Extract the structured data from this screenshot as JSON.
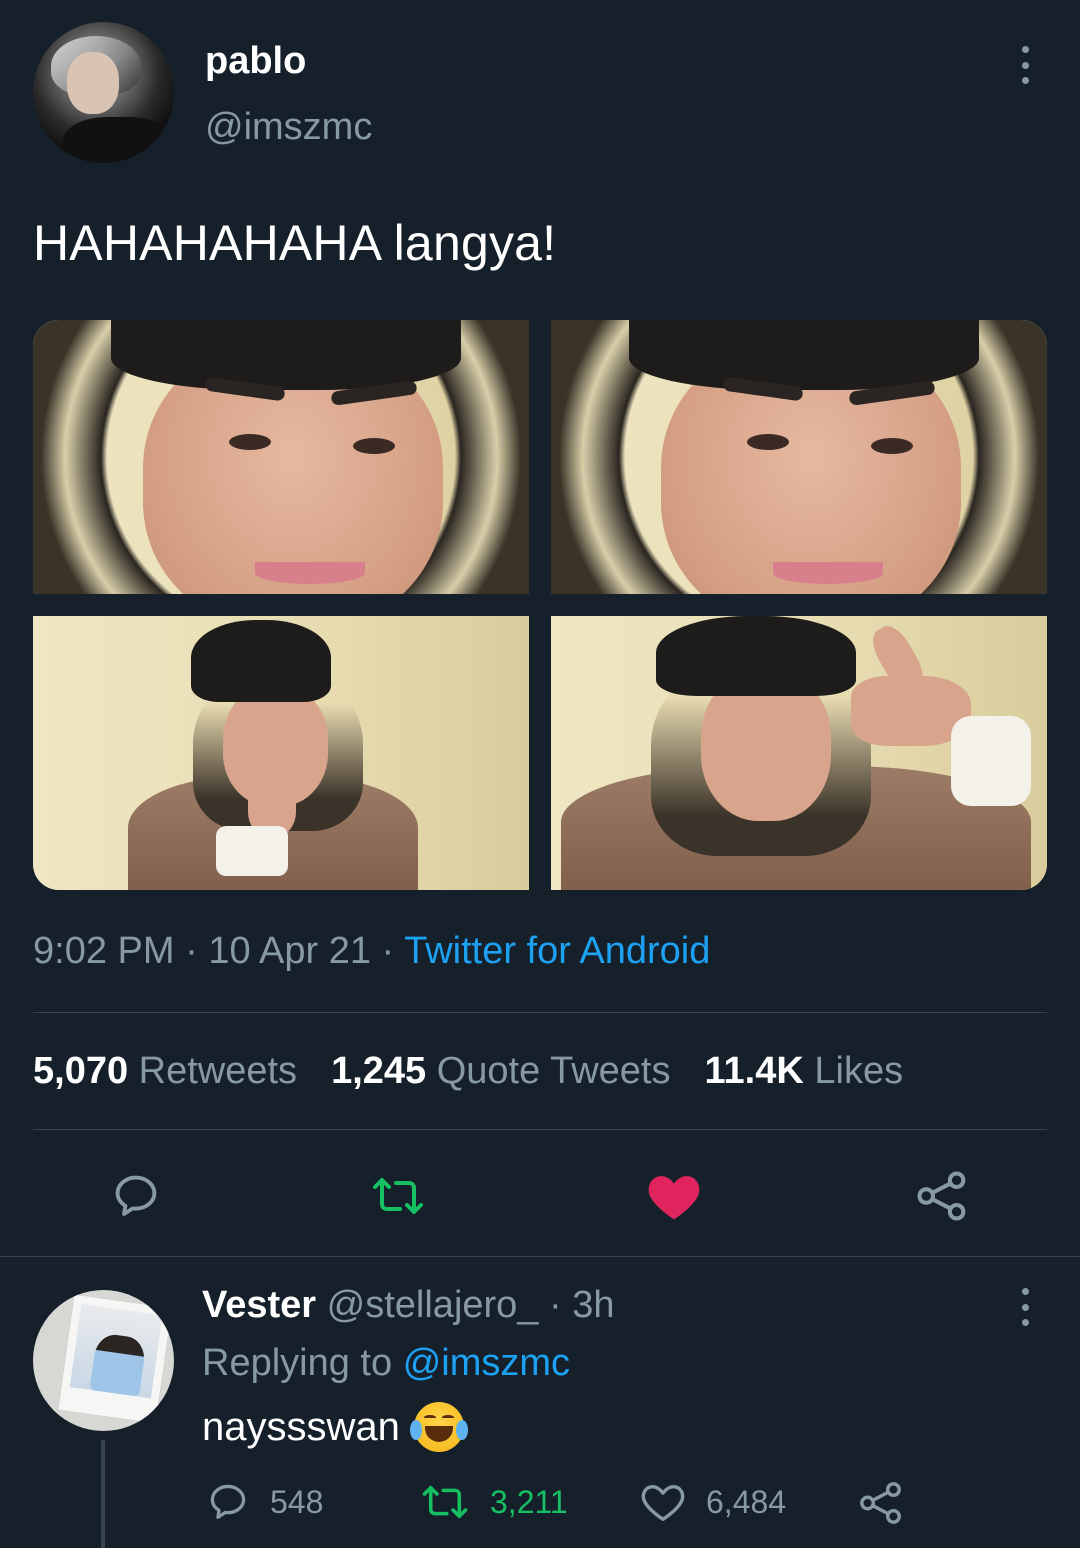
{
  "tweet": {
    "display_name": "pablo",
    "handle": "@imszmc",
    "text": "HAHAHAHAHA langya!",
    "time": "9:02 PM",
    "date": "10 Apr 21",
    "source": "Twitter for Android",
    "stats": {
      "retweets_count": "5,070",
      "retweets_label": "Retweets",
      "quotes_count": "1,245",
      "quotes_label": "Quote Tweets",
      "likes_count": "11.4K",
      "likes_label": "Likes"
    },
    "liked": true,
    "retweeted": true
  },
  "actions": {
    "reply_icon": "reply-icon",
    "retweet_icon": "retweet-icon",
    "like_icon": "heart-icon",
    "share_icon": "share-icon"
  },
  "reply": {
    "display_name": "Vester",
    "handle": "@stellajero_",
    "age": "3h",
    "replying_label": "Replying to",
    "replying_to": "@imszmc",
    "text": "nayssswan",
    "emoji": "face-with-tears-of-joy",
    "reply_count": "548",
    "retweet_count": "3,211",
    "like_count": "6,484"
  },
  "colors": {
    "background": "#15202b",
    "muted": "#8899a6",
    "accent": "#1da1f2",
    "like": "#e0245e",
    "retweet": "#17bf63"
  }
}
